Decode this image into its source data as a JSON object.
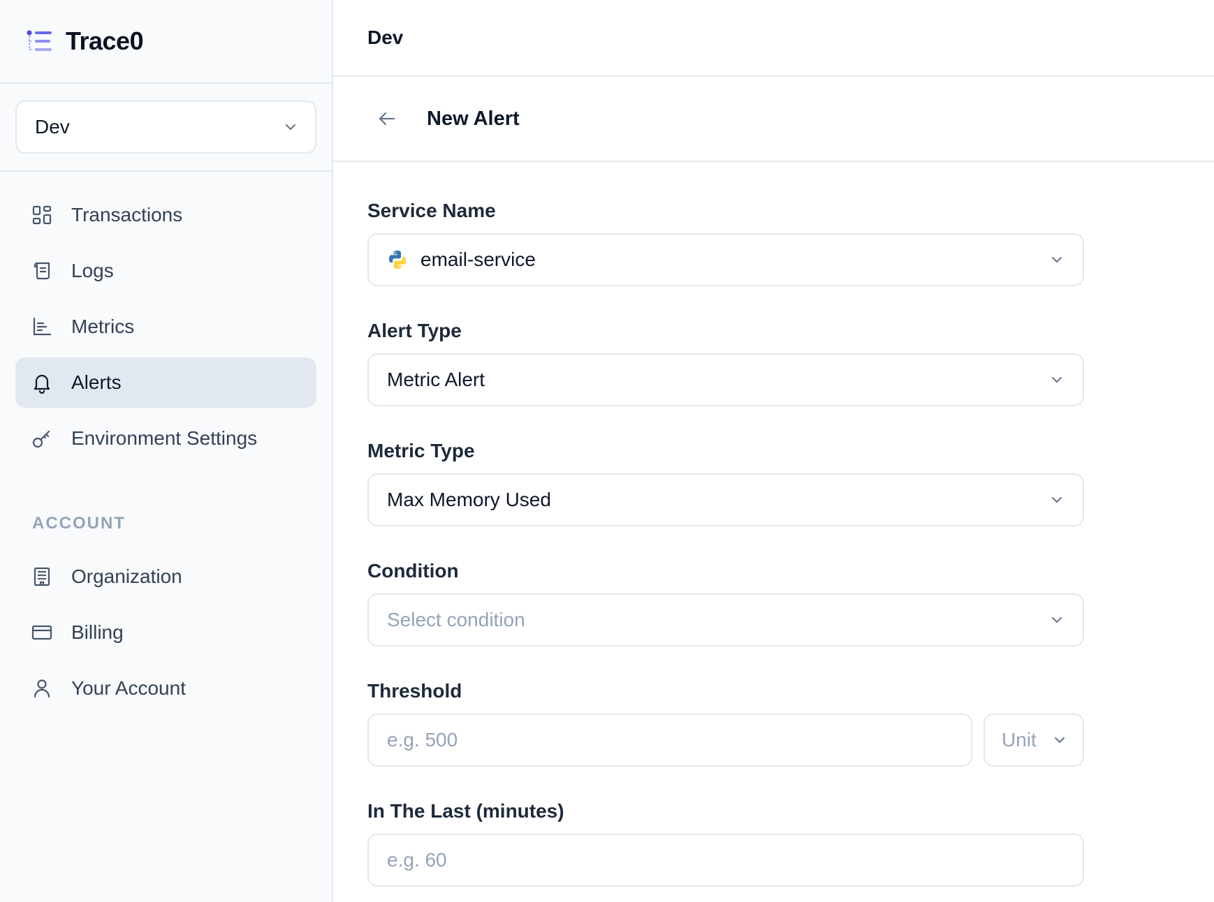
{
  "brand": {
    "name": "Trace0",
    "accent": "#6366f1"
  },
  "environment_selector": {
    "value": "Dev"
  },
  "nav": {
    "items": [
      {
        "label": "Transactions",
        "icon": "grid-icon",
        "active": false
      },
      {
        "label": "Logs",
        "icon": "scroll-icon",
        "active": false
      },
      {
        "label": "Metrics",
        "icon": "bar-chart-icon",
        "active": false
      },
      {
        "label": "Alerts",
        "icon": "bell-icon",
        "active": true
      },
      {
        "label": "Environment Settings",
        "icon": "key-icon",
        "active": false
      }
    ],
    "account_heading": "ACCOUNT",
    "account_items": [
      {
        "label": "Organization",
        "icon": "building-icon"
      },
      {
        "label": "Billing",
        "icon": "credit-card-icon"
      },
      {
        "label": "Your Account",
        "icon": "user-icon"
      }
    ]
  },
  "header": {
    "title": "Dev"
  },
  "page": {
    "title": "New Alert"
  },
  "form": {
    "service_name": {
      "label": "Service Name",
      "value": "email-service",
      "icon": "python-icon"
    },
    "alert_type": {
      "label": "Alert Type",
      "value": "Metric Alert"
    },
    "metric_type": {
      "label": "Metric Type",
      "value": "Max Memory Used"
    },
    "condition": {
      "label": "Condition",
      "placeholder": "Select condition"
    },
    "threshold": {
      "label": "Threshold",
      "placeholder": "e.g. 500",
      "unit_placeholder": "Unit"
    },
    "in_the_last": {
      "label": "In The Last (minutes)",
      "placeholder": "e.g. 60"
    }
  }
}
